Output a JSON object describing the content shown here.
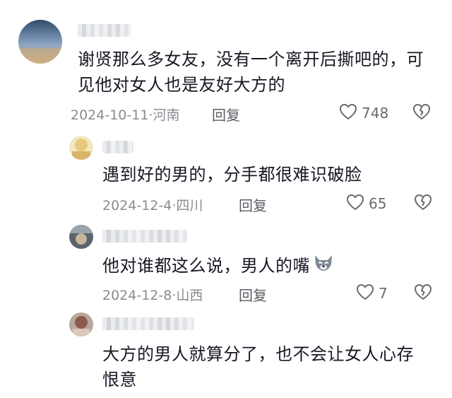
{
  "comments": [
    {
      "text": "谢贤那么多女友，没有一个离开后撕吧的，可见他对女人也是友好大方的",
      "date": "2024-10-11·河南",
      "reply_label": "回复",
      "likes": "748"
    },
    {
      "text": "遇到好的男的，分手都很难识破脸",
      "date": "2024-12-4·四川",
      "reply_label": "回复",
      "likes": "65"
    },
    {
      "text": "他对谁都这么说，男人的嘴",
      "emoji": "wolf-emoji",
      "date": "2024-12-8·山西",
      "reply_label": "回复",
      "likes": "7"
    },
    {
      "text": "大方的男人就算分了，也不会让女人心存恨意"
    }
  ],
  "colors": {
    "text": "#161823",
    "meta": "#8a8b91",
    "icon": "#6a6b72"
  }
}
